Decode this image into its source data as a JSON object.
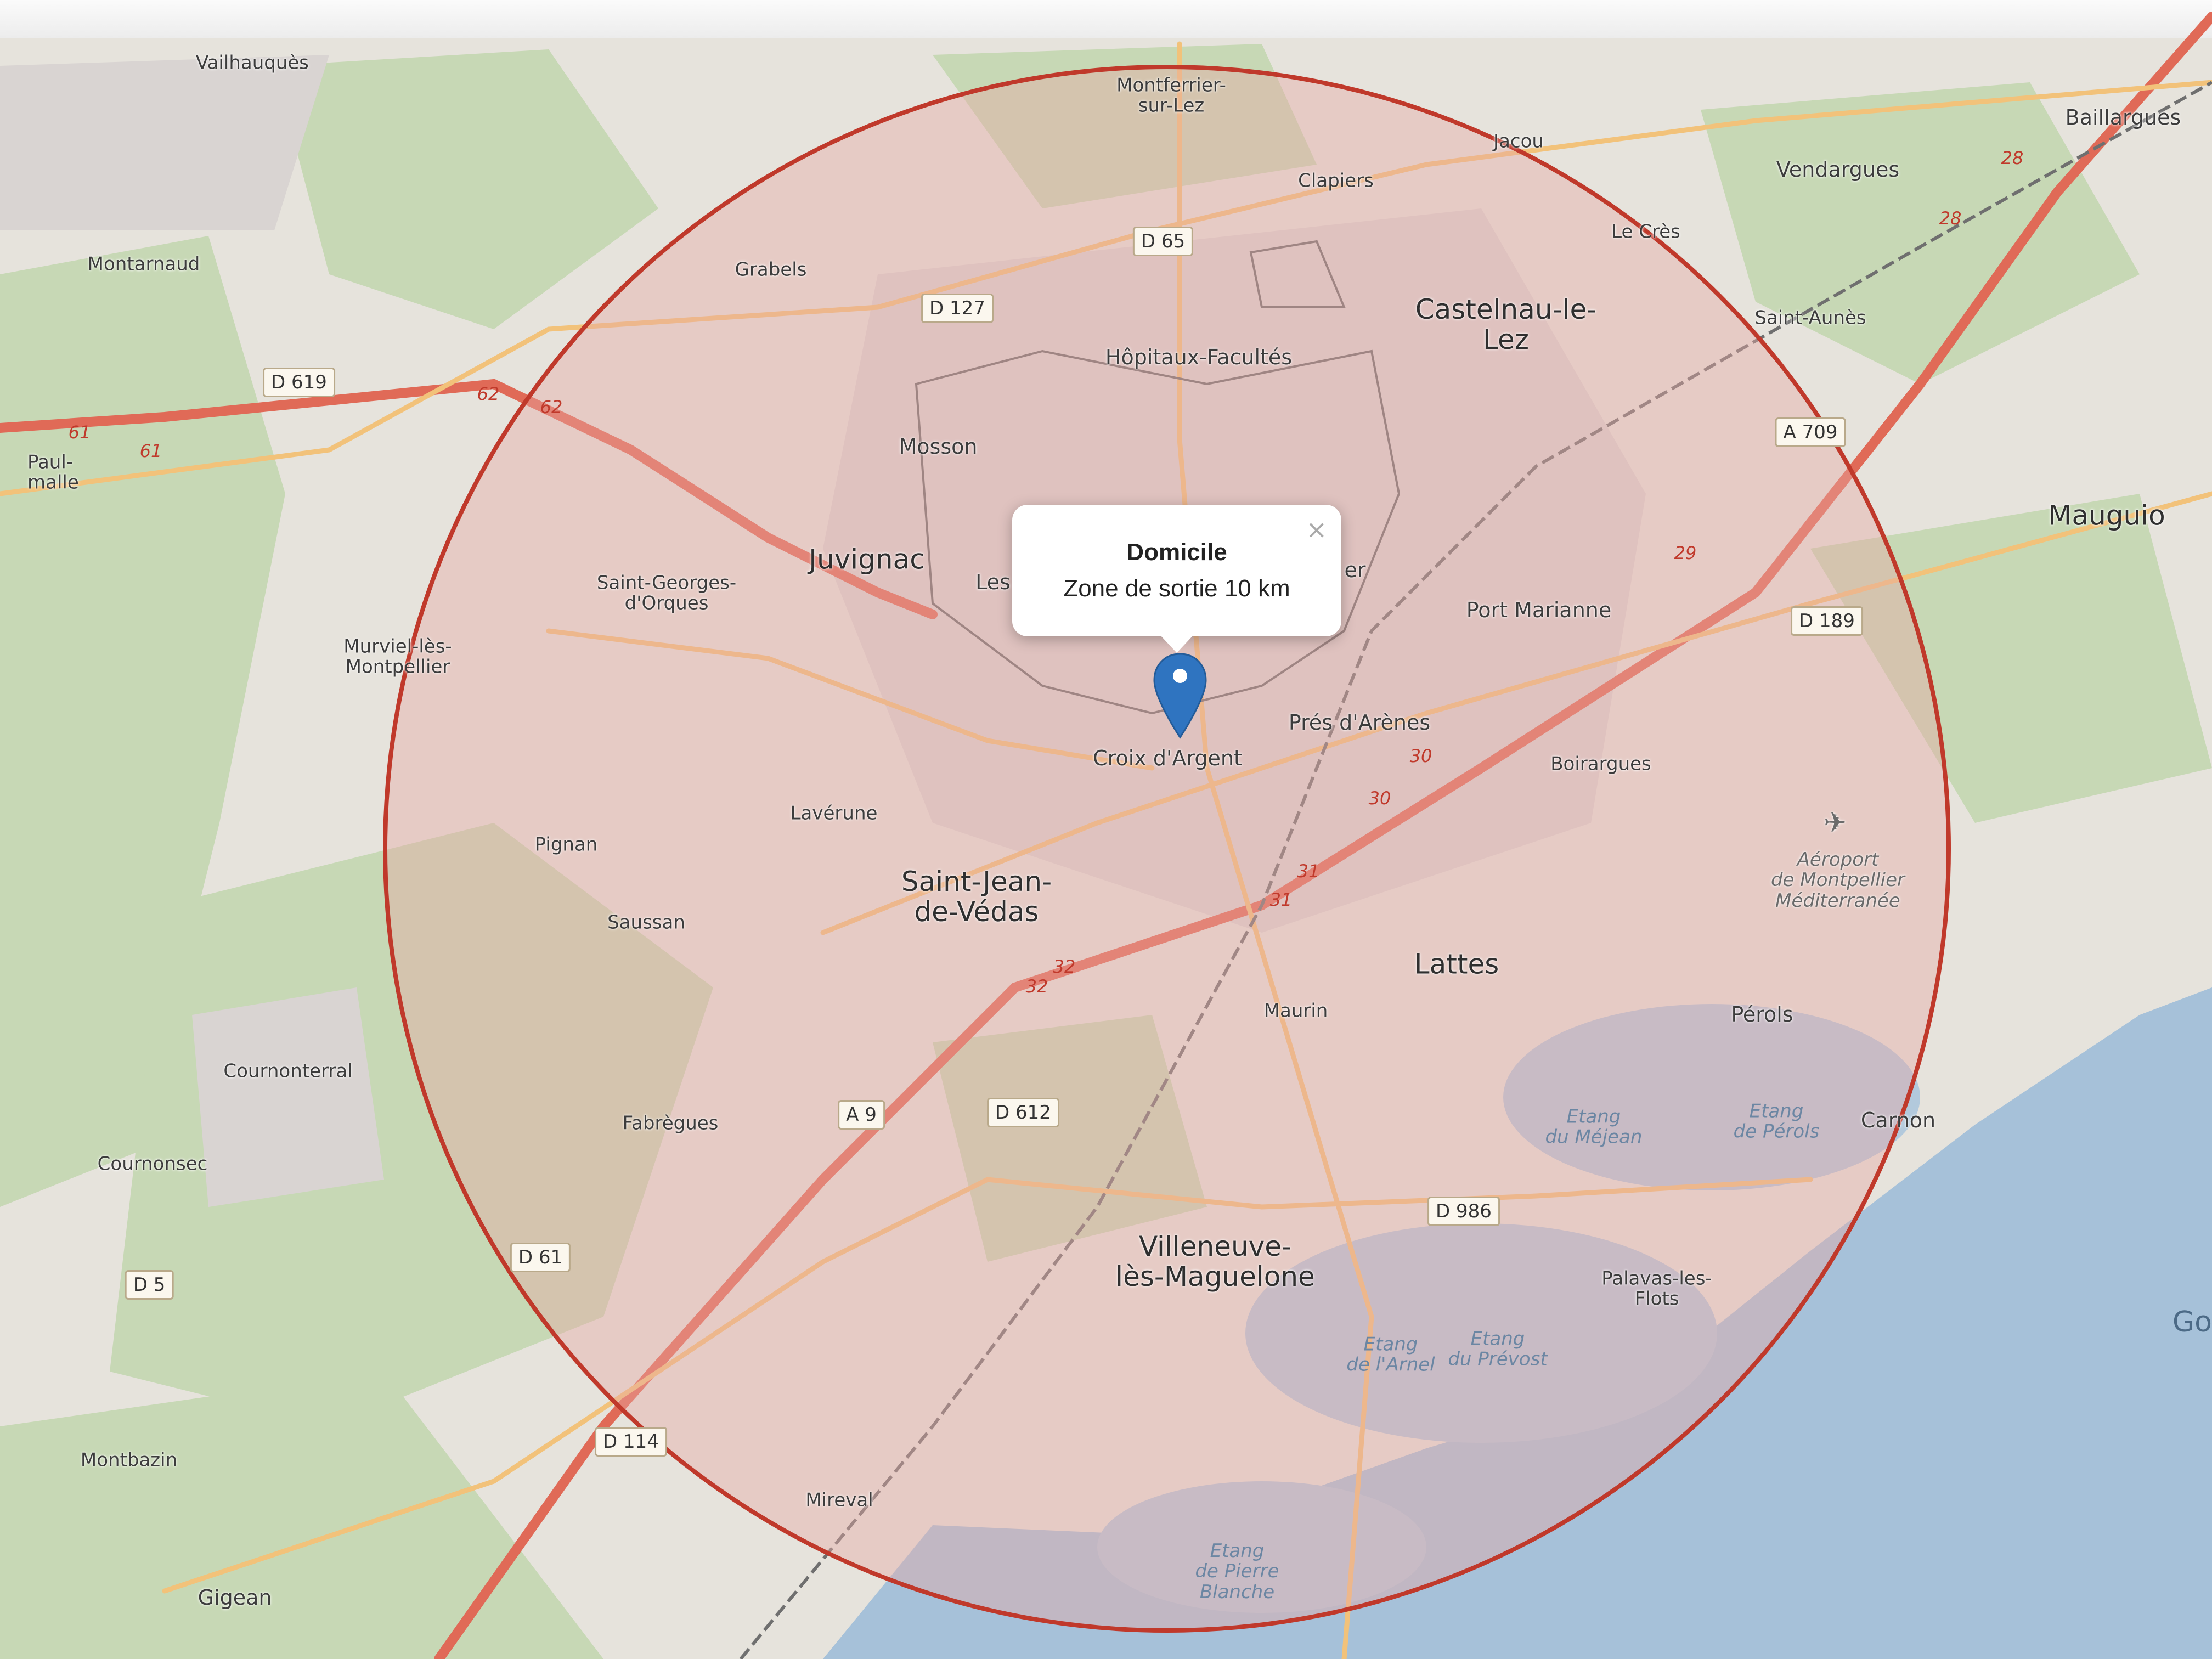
{
  "popup": {
    "title": "Domicile",
    "text": "Zone de sortie 10 km",
    "close_glyph": "×"
  },
  "marker": {
    "icon": "map-pin-icon",
    "color": "#2f74c0"
  },
  "zone": {
    "radius_label": "10 km",
    "border_color": "#c0392b",
    "fill_color": "#e8a9a4"
  },
  "places": {
    "vailhauques": "Vailhauquès",
    "montferrier": "Montferrier-\nsur-Lez",
    "jacou": "Jacou",
    "baillargues": "Baillargues",
    "clapiers": "Clapiers",
    "vendargues": "Vendargues",
    "montarnaud": "Montarnaud",
    "grabels": "Grabels",
    "le_cres": "Le Crès",
    "castelnau": "Castelnau-le-\nLez",
    "saint_aunes": "Saint-Aunès",
    "hopitaux": "Hôpitaux-Facultés",
    "paulhan": "Paul-\nmalle",
    "mosson": "Mosson",
    "mauguio": "Mauguio",
    "juvignac": "Juvignac",
    "les": "Les",
    "er": "er",
    "saint_georges": "Saint-Georges-\nd'Orques",
    "port_marianne": "Port Marianne",
    "murviel": "Murviel-lès-\nMontpellier",
    "pres_arenes": "Prés d'Arènes",
    "croix_argent": "Croix d'Argent",
    "boirargues": "Boirargues",
    "laverune": "Lavérune",
    "pignan": "Pignan",
    "saint_jean": "Saint-Jean-\nde-Védas",
    "saussan": "Saussan",
    "lattes": "Lattes",
    "maurin": "Maurin",
    "perols": "Pérols",
    "cournonterral": "Cournonterral",
    "fabregues": "Fabrègues",
    "carnon": "Carnon",
    "cournonsec": "Cournonsec",
    "villeneuve": "Villeneuve-\nlès-Maguelone",
    "palavas": "Palavas-les-\nFlots",
    "montbazin": "Montbazin",
    "mireval": "Mireval",
    "gigean": "Gigean",
    "edge_go": "Go"
  },
  "water": {
    "mejean": "Etang\ndu Méjean",
    "perols": "Etang\nde Pérols",
    "arnel": "Etang\nde l'Arnel",
    "prevost": "Etang\ndu Prévost",
    "pierre_blanche": "Etang\nde Pierre\nBlanche"
  },
  "airport": "Aéroport\nde Montpellier\nMéditerranée",
  "road_shields": {
    "d65": "D 65",
    "d127": "D 127",
    "d619": "D 619",
    "a709": "A 709",
    "d189": "D 189",
    "a9": "A 9",
    "d612": "D 612",
    "d986": "D 986",
    "d613": "D 61",
    "d5": "D 5",
    "d114": "D 114"
  },
  "motorway_exits": [
    "61",
    "61",
    "62",
    "62",
    "28",
    "28",
    "29",
    "30",
    "30",
    "31",
    "31",
    "32",
    "32"
  ],
  "colors": {
    "land": "#e8e4dc",
    "forest": "#c5d7b4",
    "water": "#a9c3da",
    "motorway": "#e06a57",
    "primary_road": "#f2c27a"
  }
}
